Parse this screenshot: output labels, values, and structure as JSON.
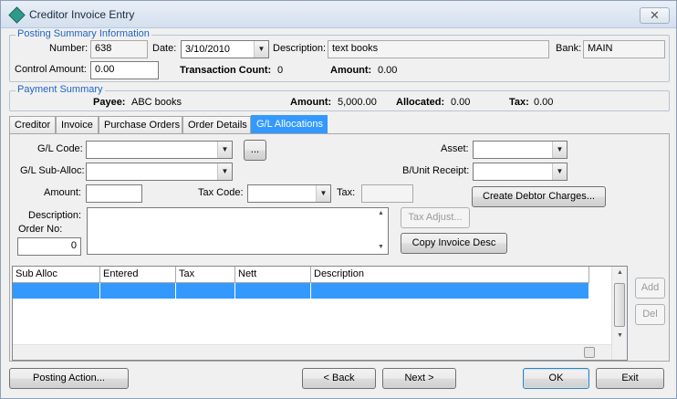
{
  "window": {
    "title": "Creditor Invoice Entry",
    "close_symbol": "✕"
  },
  "posting_summary": {
    "title": "Posting Summary Information",
    "number_label": "Number:",
    "number_value": "638",
    "date_label": "Date:",
    "date_value": "3/10/2010",
    "description_label": "Description:",
    "description_value": "text books",
    "bank_label": "Bank:",
    "bank_value": "MAIN",
    "control_amount_label": "Control Amount:",
    "control_amount_value": "0.00",
    "transaction_count_label": "Transaction Count:",
    "transaction_count_value": "0",
    "amount_label": "Amount:",
    "amount_value": "0.00"
  },
  "payment_summary": {
    "title": "Payment Summary",
    "payee_label": "Payee:",
    "payee_value": "ABC books",
    "amount_label": "Amount:",
    "amount_value": "5,000.00",
    "allocated_label": "Allocated:",
    "allocated_value": "0.00",
    "tax_label": "Tax:",
    "tax_value": "0.00"
  },
  "tabs": [
    {
      "label": "Creditor",
      "active": false
    },
    {
      "label": "Invoice",
      "active": false
    },
    {
      "label": "Purchase Orders",
      "active": false
    },
    {
      "label": "Order Details",
      "active": false
    },
    {
      "label": "G/L Allocations",
      "active": true
    }
  ],
  "gl_form": {
    "gl_code_label": "G/L Code:",
    "gl_code_value": "",
    "browse_label": "...",
    "gl_suballoc_label": "G/L Sub-Alloc:",
    "gl_suballoc_value": "",
    "amount_label": "Amount:",
    "amount_value": "",
    "tax_code_label": "Tax Code:",
    "tax_code_value": "",
    "tax_label": "Tax:",
    "tax_value": "",
    "description_label": "Description:",
    "order_no_label": "Order No:",
    "order_no_value": "0",
    "asset_label": "Asset:",
    "asset_value": "",
    "bunit_receipt_label": "B/Unit Receipt:",
    "bunit_receipt_value": "",
    "create_debtor_charges_label": "Create Debtor Charges...",
    "tax_adjust_label": "Tax Adjust...",
    "copy_invoice_desc_label": "Copy Invoice Desc"
  },
  "grid": {
    "columns": [
      "Sub Alloc",
      "Entered",
      "Tax",
      "Nett",
      "Description"
    ],
    "rows": [
      [
        "",
        "",
        "",
        "",
        ""
      ]
    ]
  },
  "side_buttons": {
    "add_label": "Add",
    "del_label": "Del"
  },
  "footer": {
    "posting_action_label": "Posting Action...",
    "back_label": "< Back",
    "next_label": "Next >",
    "ok_label": "OK",
    "exit_label": "Exit"
  }
}
